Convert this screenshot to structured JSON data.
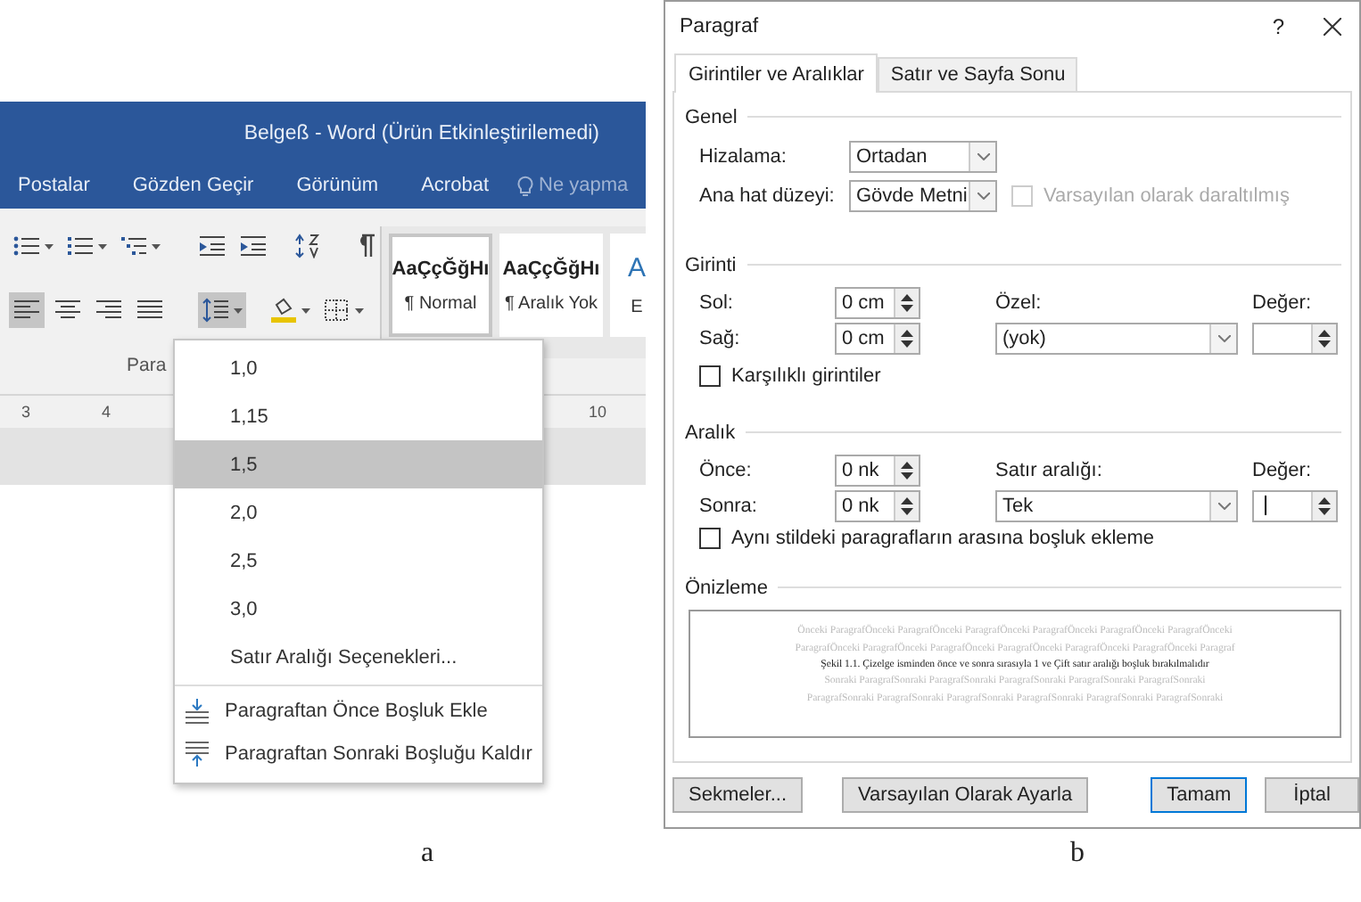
{
  "figure_a": {
    "caption": "a",
    "title_bar": {
      "title": "Belgeß - Word (Ürün Etkinleştirilemedi)"
    },
    "ribbon_tabs": [
      "Postalar",
      "Gözden Geçir",
      "Görünüm",
      "Acrobat"
    ],
    "tell_me": {
      "placeholder": "Ne yapma"
    },
    "ribbon_rows": [
      [
        {
          "kind": "bullets",
          "dropdown": true,
          "pressed": false
        },
        {
          "kind": "numbering",
          "dropdown": true,
          "pressed": false
        },
        {
          "kind": "multilevel",
          "dropdown": true,
          "pressed": false
        },
        {
          "kind": "outdent",
          "dropdown": false,
          "pressed": false
        },
        {
          "kind": "indent",
          "dropdown": false,
          "pressed": false
        },
        {
          "kind": "sort",
          "dropdown": false,
          "pressed": false
        },
        {
          "kind": "pilcrow",
          "dropdown": false,
          "pressed": false
        }
      ],
      [
        {
          "kind": "align-left",
          "dropdown": false,
          "pressed": true
        },
        {
          "kind": "align-center",
          "dropdown": false,
          "pressed": false
        },
        {
          "kind": "align-right",
          "dropdown": false,
          "pressed": false
        },
        {
          "kind": "justify",
          "dropdown": false,
          "pressed": false
        },
        {
          "kind": "line-spacing",
          "dropdown": true,
          "pressed": true
        },
        {
          "kind": "shading",
          "dropdown": true,
          "pressed": false
        },
        {
          "kind": "borders",
          "dropdown": true,
          "pressed": false
        }
      ]
    ],
    "group_label": "Para",
    "styles": [
      {
        "preview": "AaÇçĞğHı",
        "name": "¶ Normal",
        "kind": "body",
        "selected": true
      },
      {
        "preview": "AaÇçĞğHı",
        "name": "¶ Aralık Yok",
        "kind": "body",
        "selected": false
      },
      {
        "preview": "A",
        "name": "E",
        "kind": "heading",
        "selected": false
      }
    ],
    "ruler_marks": [
      "3",
      "4",
      "10"
    ],
    "menu": [
      {
        "kind": "option",
        "label": "1,0",
        "selected": false
      },
      {
        "kind": "option",
        "label": "1,15",
        "selected": false
      },
      {
        "kind": "option",
        "label": "1,5",
        "selected": true
      },
      {
        "kind": "option",
        "label": "2,0",
        "selected": false
      },
      {
        "kind": "option",
        "label": "2,5",
        "selected": false
      },
      {
        "kind": "option",
        "label": "3,0",
        "selected": false
      },
      {
        "kind": "option",
        "label": "Satır Aralığı Seçenekleri...",
        "selected": false
      },
      {
        "kind": "add-before",
        "label": "Paragraftan Önce Boşluk Ekle",
        "selected": false
      },
      {
        "kind": "remove-after",
        "label": "Paragraftan Sonraki Boşluğu Kaldır",
        "selected": false
      }
    ]
  },
  "figure_b": {
    "caption": "b",
    "dialog": {
      "title": "Paragraf",
      "help": "?"
    },
    "tabs": [
      {
        "label": "Girintiler ve Aralıklar",
        "selected": true
      },
      {
        "label": "Satır ve Sayfa Sonu",
        "selected": false
      }
    ],
    "general": {
      "title": "Genel",
      "alignment": {
        "label": "Hizalama:",
        "value": "Ortadan"
      },
      "outline_level": {
        "label": "Ana hat düzeyi:",
        "value": "Gövde Metni"
      },
      "collapsed": {
        "label": "Varsayılan olarak daraltılmış",
        "checked": false,
        "disabled": true
      }
    },
    "indentation": {
      "title": "Girinti",
      "left": {
        "label": "Sol:",
        "value": "0 cm"
      },
      "right": {
        "label": "Sağ:",
        "value": "0 cm"
      },
      "special": {
        "label": "Özel:",
        "value": "(yok)"
      },
      "by": {
        "label": "Değer:"
      },
      "mirror": {
        "label": "Karşılıklı girintiler",
        "checked": false,
        "disabled": false
      }
    },
    "spacing": {
      "title": "Aralık",
      "before": {
        "label": "Önce:",
        "value": "0 nk"
      },
      "after": {
        "label": "Sonra:",
        "value": "0 nk"
      },
      "line_spacing": {
        "label": "Satır aralığı:",
        "value": "Tek"
      },
      "at": {
        "label": "Değer:",
        "focused": true
      },
      "dont_add": {
        "label": "Aynı stildeki paragrafların arasına boşluk ekleme",
        "checked": false,
        "disabled": false
      }
    },
    "preview": {
      "title": "Önizleme",
      "previous": [
        "Önceki ParagrafÖnceki ParagrafÖnceki ParagrafÖnceki ParagrafÖnceki ParagrafÖnceki ParagrafÖnceki",
        "ParagrafÖnceki ParagrafÖnceki ParagrafÖnceki ParagrafÖnceki ParagrafÖnceki ParagrafÖnceki Paragraf"
      ],
      "sample": "Şekil 1.1. Çizelge isminden önce ve sonra sırasıyla 1 ve Çift satır aralığı boşluk bırakılmalıdır",
      "following": [
        "Sonraki ParagrafSonraki ParagrafSonraki ParagrafSonraki ParagrafSonraki ParagrafSonraki",
        "ParagrafSonraki ParagrafSonraki ParagrafSonraki ParagrafSonraki ParagrafSonraki ParagrafSonraki"
      ]
    },
    "buttons": [
      {
        "label": "Sekmeler...",
        "kind": "normal"
      },
      {
        "label": "Varsayılan Olarak Ayarla",
        "kind": "normal"
      },
      {
        "label": "Tamam",
        "kind": "default"
      },
      {
        "label": "İptal",
        "kind": "normal"
      }
    ]
  }
}
